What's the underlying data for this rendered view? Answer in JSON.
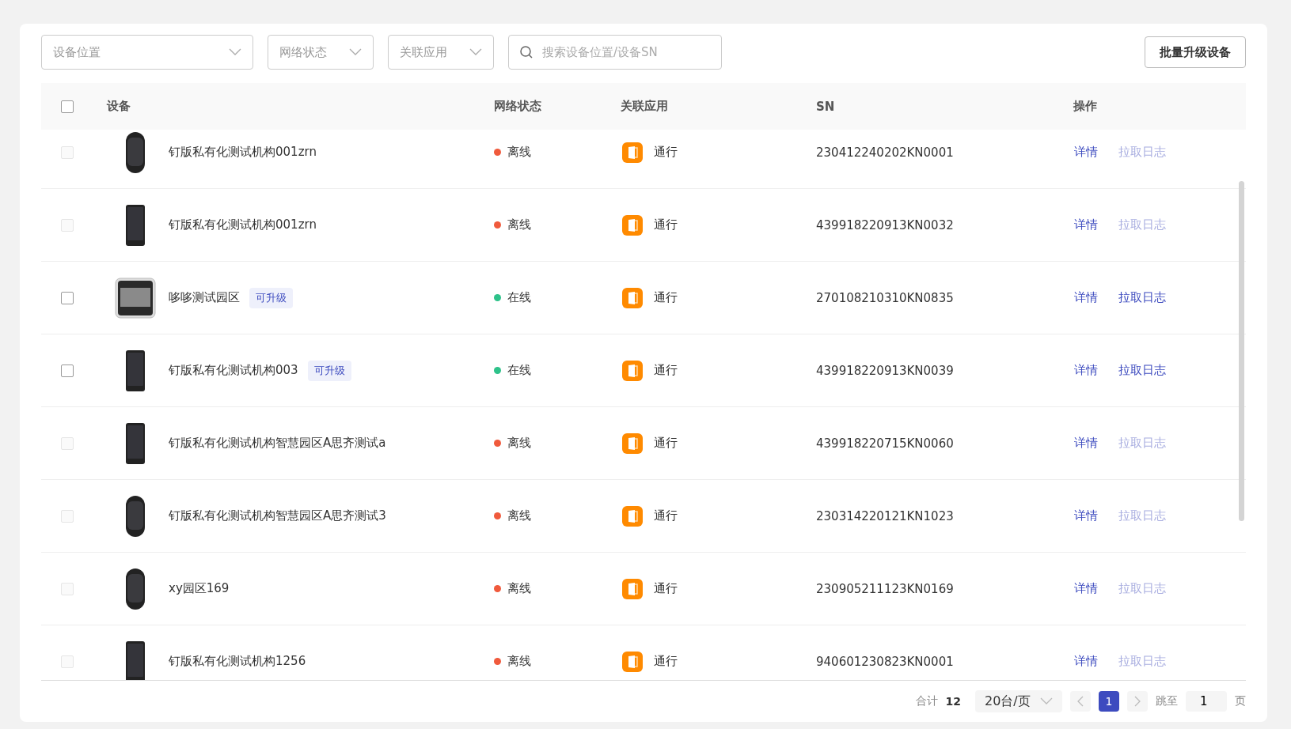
{
  "filters": [
    {
      "kind": "wideselect",
      "placeholder": "设备位置"
    },
    {
      "kind": "select",
      "placeholder": "网络状态"
    },
    {
      "kind": "select",
      "placeholder": "关联应用"
    },
    {
      "kind": "search",
      "placeholder": "搜索设备位置/设备SN"
    }
  ],
  "batch_button": "批量升级设备",
  "table": {
    "select_all_checked": false,
    "columns": [
      "设备",
      "网络状态",
      "关联应用",
      "SN",
      "操作"
    ],
    "rows": [
      {
        "checked": false,
        "disabled": true,
        "kind": "round",
        "name": "钉版私有化测试机构001zrn",
        "status": "离线",
        "color": "#f05a3c",
        "app": "通行",
        "sn": "230412240202KN0001",
        "actions": [
          {
            "label": "详情",
            "disabled": false
          },
          {
            "label": "拉取日志",
            "disabled": true
          }
        ]
      },
      {
        "checked": false,
        "disabled": true,
        "kind": "phone",
        "name": "钉版私有化测试机构001zrn",
        "status": "离线",
        "color": "#f05a3c",
        "app": "通行",
        "sn": "439918220913KN0032",
        "actions": [
          {
            "label": "详情",
            "disabled": false
          },
          {
            "label": "拉取日志",
            "disabled": true
          }
        ]
      },
      {
        "checked": false,
        "disabled": false,
        "kind": "panel",
        "name": "哆哆测试园区",
        "badge": "可升级",
        "status": "在线",
        "color": "#2ec28a",
        "app": "通行",
        "sn": "270108210310KN0835",
        "actions": [
          {
            "label": "详情",
            "disabled": false
          },
          {
            "label": "拉取日志",
            "disabled": false
          }
        ]
      },
      {
        "checked": false,
        "disabled": false,
        "kind": "phone",
        "name": "钉版私有化测试机构003",
        "badge": "可升级",
        "status": "在线",
        "color": "#2ec28a",
        "app": "通行",
        "sn": "439918220913KN0039",
        "actions": [
          {
            "label": "详情",
            "disabled": false
          },
          {
            "label": "拉取日志",
            "disabled": false
          }
        ]
      },
      {
        "checked": false,
        "disabled": true,
        "kind": "phone",
        "name": "钉版私有化测试机构智慧园区A思齐测试a",
        "status": "离线",
        "color": "#f05a3c",
        "app": "通行",
        "sn": "439918220715KN0060",
        "actions": [
          {
            "label": "详情",
            "disabled": false
          },
          {
            "label": "拉取日志",
            "disabled": true
          }
        ]
      },
      {
        "checked": false,
        "disabled": true,
        "kind": "round",
        "name": "钉版私有化测试机构智慧园区A思齐测试3",
        "status": "离线",
        "color": "#f05a3c",
        "app": "通行",
        "sn": "230314220121KN1023",
        "actions": [
          {
            "label": "详情",
            "disabled": false
          },
          {
            "label": "拉取日志",
            "disabled": true
          }
        ]
      },
      {
        "checked": false,
        "disabled": true,
        "kind": "round",
        "name": "xy园区169",
        "status": "离线",
        "color": "#f05a3c",
        "app": "通行",
        "sn": "230905211123KN0169",
        "actions": [
          {
            "label": "详情",
            "disabled": false
          },
          {
            "label": "拉取日志",
            "disabled": true
          }
        ]
      },
      {
        "checked": false,
        "disabled": true,
        "kind": "phone",
        "name": "钉版私有化测试机构1256",
        "status": "离线",
        "color": "#f05a3c",
        "app": "通行",
        "sn": "940601230823KN0001",
        "actions": [
          {
            "label": "详情",
            "disabled": false
          },
          {
            "label": "拉取日志",
            "disabled": true
          }
        ]
      }
    ]
  },
  "pagination": {
    "total_label": "合计",
    "total": "12",
    "page_size": "20台/页",
    "pages": [
      {
        "label": "1",
        "selected": true
      }
    ],
    "jump_label": "跳至",
    "jump_value": "1",
    "page_unit": "页"
  }
}
